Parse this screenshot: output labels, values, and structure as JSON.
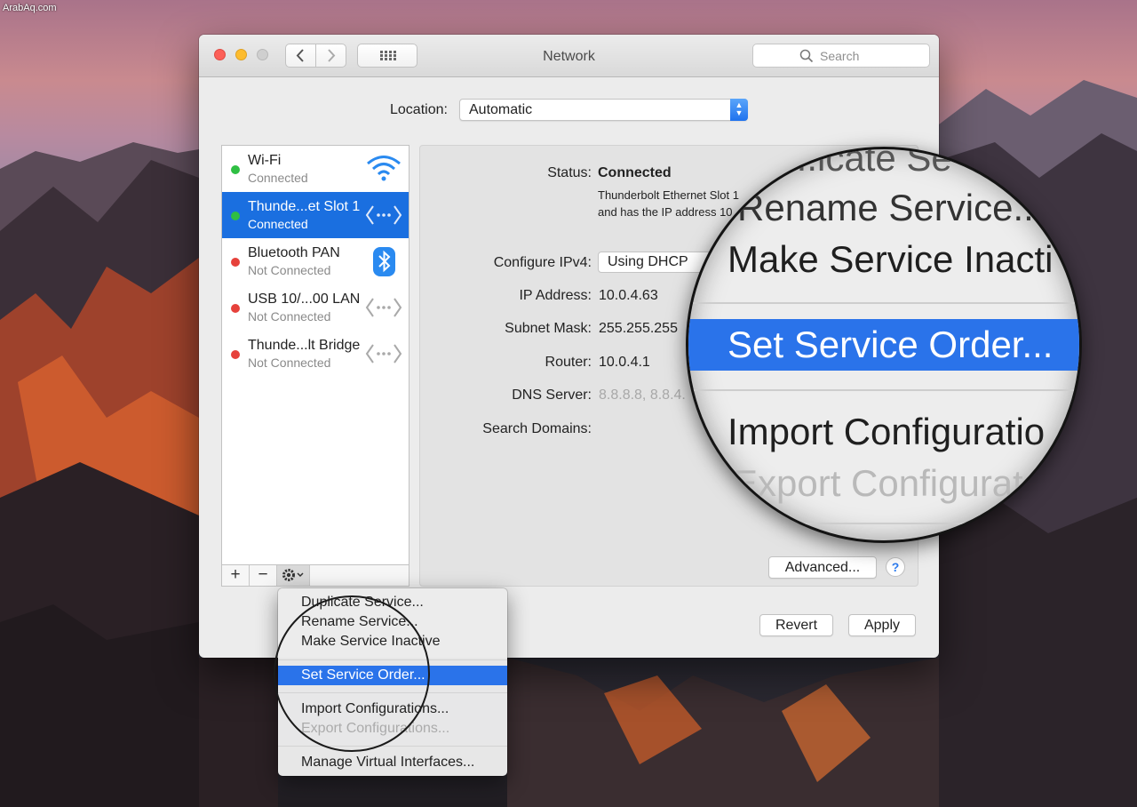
{
  "watermark": "ArabAq.com",
  "window": {
    "title": "Network",
    "search_placeholder": "Search"
  },
  "location": {
    "label": "Location:",
    "value": "Automatic"
  },
  "services": [
    {
      "name": "Wi-Fi",
      "status": "Connected",
      "icon": "wifi-icon",
      "status_color": "#2fbf43",
      "selected": false
    },
    {
      "name": "Thunde...et Slot 1",
      "status": "Connected",
      "icon": "ethernet-icon",
      "status_color": "#2fbf43",
      "selected": true
    },
    {
      "name": "Bluetooth PAN",
      "status": "Not Connected",
      "icon": "bluetooth-icon",
      "status_color": "#e6413b",
      "selected": false
    },
    {
      "name": "USB 10/...00 LAN",
      "status": "Not Connected",
      "icon": "ethernet-icon",
      "status_color": "#e6413b",
      "selected": false
    },
    {
      "name": "Thunde...lt Bridge",
      "status": "Not Connected",
      "icon": "ethernet-icon",
      "status_color": "#e6413b",
      "selected": false
    }
  ],
  "list_footer": {
    "add": "+",
    "remove": "−"
  },
  "detail": {
    "status_label": "Status:",
    "status_value": "Connected",
    "status_desc_1": "Thunderbolt Ethernet Slot 1",
    "status_desc_2": "and has the IP address 10",
    "ipv4_label": "Configure IPv4:",
    "ipv4_value": "Using DHCP",
    "ip_label": "IP Address:",
    "ip_value": "10.0.4.63",
    "subnet_label": "Subnet Mask:",
    "subnet_value": "255.255.255",
    "router_label": "Router:",
    "router_value": "10.0.4.1",
    "dns_label": "DNS Server:",
    "dns_value": "8.8.8.8, 8.8.4.",
    "search_domains_label": "Search Domains:",
    "advanced_button": "Advanced...",
    "help_button": "?"
  },
  "bottom_buttons": {
    "revert": "Revert",
    "apply": "Apply"
  },
  "menu": {
    "items": [
      {
        "label": "Duplicate Service...",
        "enabled": true
      },
      {
        "label": "Rename Service...",
        "enabled": true
      },
      {
        "label": "Make Service Inactive",
        "enabled": true
      },
      {
        "label": "Set Service Order...",
        "enabled": true,
        "highlighted": true
      },
      {
        "label": "Import Configurations...",
        "enabled": true
      },
      {
        "label": "Export Configurations...",
        "enabled": false
      },
      {
        "label": "Manage Virtual Interfaces...",
        "enabled": true
      }
    ]
  },
  "magnifier": {
    "line_0": "...icate Se",
    "line_1": "Rename Service...",
    "line_2": "Make Service Inacti",
    "line_3": "Set Service Order...",
    "line_4": "Import Configuratio",
    "line_5": "Export Configurat"
  },
  "colors": {
    "selection": "#1a6fe0",
    "menu_highlight": "#2a73ea"
  }
}
